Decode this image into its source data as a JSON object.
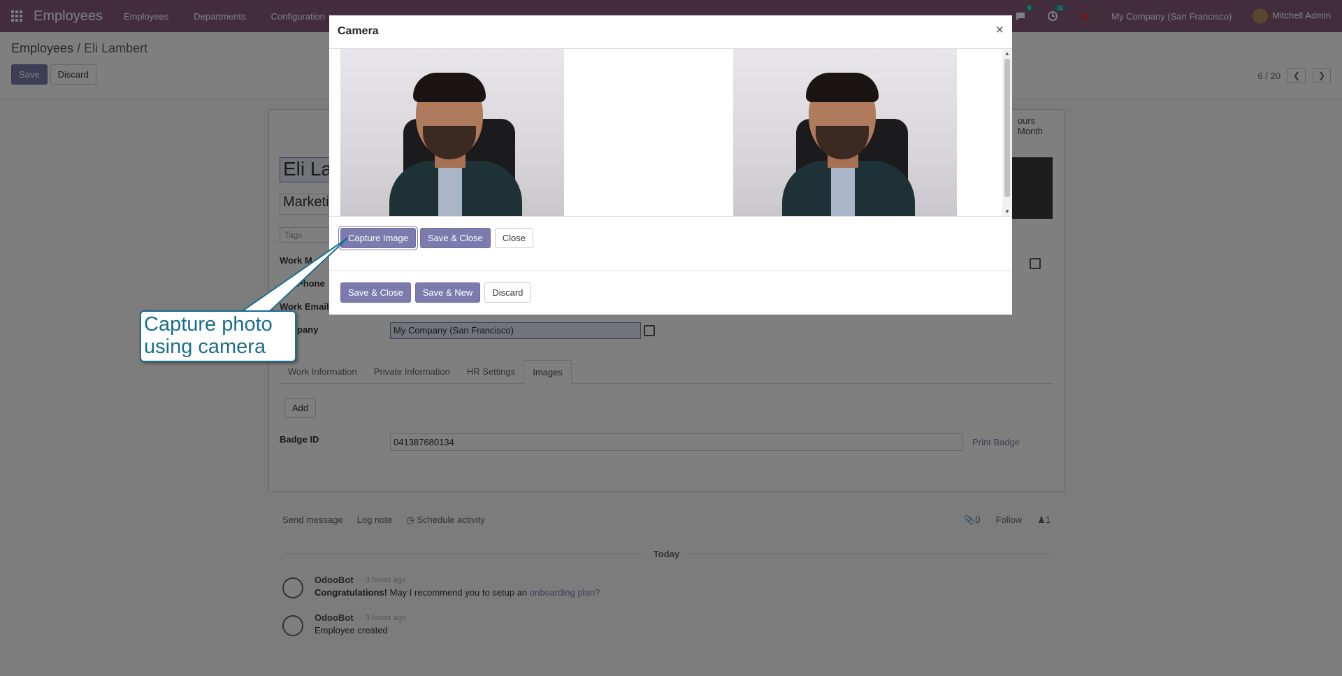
{
  "navbar": {
    "app_name": "Employees",
    "menu": [
      "Employees",
      "Departments",
      "Configuration"
    ],
    "messages_count": "9",
    "activities_count": "32",
    "company": "My Company (San Francisco)",
    "user": "Mitchell Admin"
  },
  "control_panel": {
    "breadcrumb_parent": "Employees",
    "breadcrumb_sep": "/",
    "breadcrumb_current": "Eli Lambert",
    "save_label": "Save",
    "discard_label": "Discard",
    "pager": "6 / 20"
  },
  "form": {
    "smart_button_line1": "ours",
    "smart_button_line2": "Month",
    "name": "Eli La",
    "job_title": "Marketi",
    "tags_placeholder": "Tags",
    "labels": {
      "work_mobile": "Work M",
      "work_phone": "Phone",
      "work_email": "Work Email",
      "company": "pany"
    },
    "company_value": "My Company (San Francisco)",
    "tabs": [
      "Work Information",
      "Private Information",
      "HR Settings",
      "Images"
    ],
    "active_tab": "Images",
    "add_label": "Add",
    "badge_label": "Badge ID",
    "badge_value": "041387680134",
    "print_badge": "Print Badge"
  },
  "chatter": {
    "send_message": "Send message",
    "log_note": "Log note",
    "schedule_activity": "Schedule activity",
    "attachments": "0",
    "follow": "Follow",
    "followers": "1",
    "date_separator": "Today",
    "messages": [
      {
        "author": "OdooBot",
        "time": "- 3 hours ago",
        "bold": "Congratulations!",
        "text": " May I recommend you to setup an ",
        "link": "onboarding plan?"
      },
      {
        "author": "OdooBot",
        "time": "- 3 hours ago",
        "bold": "",
        "text": "Employee created",
        "link": ""
      }
    ]
  },
  "underlying_dialog": {
    "save_close": "Save & Close",
    "save_new": "Save & New",
    "discard": "Discard"
  },
  "camera_dialog": {
    "title": "Camera",
    "close_symbol": "×",
    "capture_label": "Capture Image",
    "save_close_label": "Save & Close",
    "close_label": "Close"
  },
  "callout": {
    "line1": "Capture photo",
    "line2": "using camera"
  },
  "colors": {
    "brand": "#875a7b",
    "primary_button": "#7c7bad",
    "callout": "#1a6e8e"
  }
}
